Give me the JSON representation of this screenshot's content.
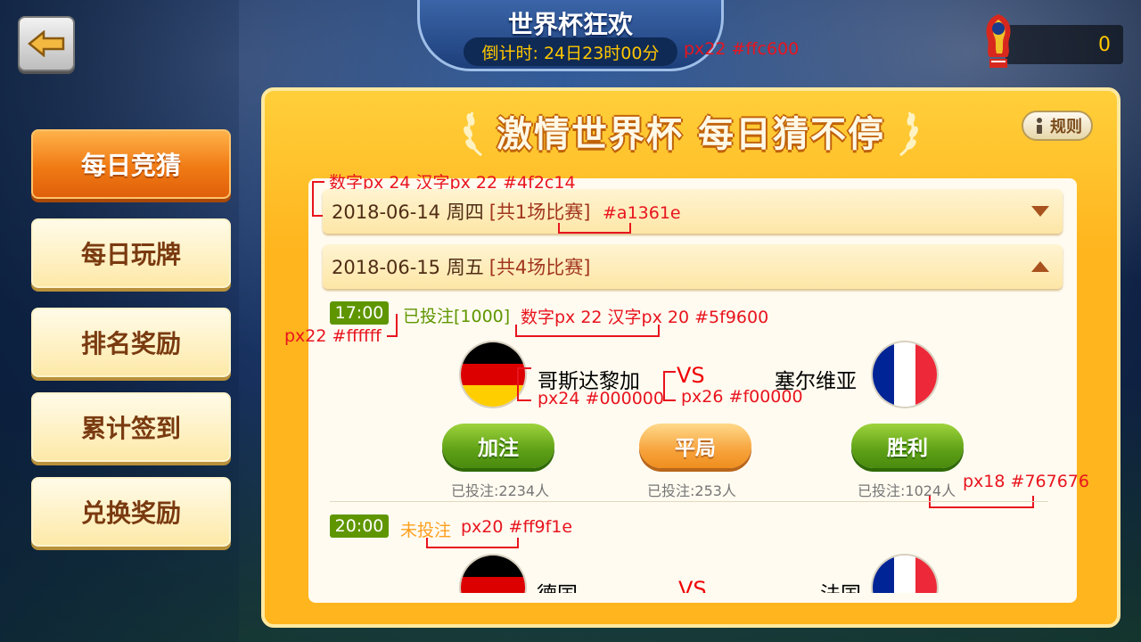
{
  "header": {
    "title": "世界杯狂欢",
    "countdown": "倒计时: 24日23时00分",
    "countdown_note": "px22 #ffc600",
    "score": "0"
  },
  "sidebar": {
    "items": [
      {
        "label": "每日竞猜",
        "active": true
      },
      {
        "label": "每日玩牌",
        "active": false
      },
      {
        "label": "排名奖励",
        "active": false
      },
      {
        "label": "累计签到",
        "active": false
      },
      {
        "label": "兑换奖励",
        "active": false
      }
    ]
  },
  "panel": {
    "title": "激情世界杯 每日猜不停",
    "rules_label": "规则"
  },
  "notes": {
    "date_font": "数字px 24  汉字px 22 #4f2c14",
    "count_color": "#a1361e",
    "time_badge": "px22 #ffffff",
    "bet_status": "数字px 22  汉字px 20 #5f9600",
    "team_font": "px24 #000000",
    "vs_font": "px26 #f00000",
    "bet_count": "px18 #767676",
    "not_bet": "px20 #ff9f1e"
  },
  "days": [
    {
      "date": "2018-06-14 周四",
      "count": "[共1场比赛]",
      "expanded": false
    },
    {
      "date": "2018-06-15 周五",
      "count": "[共4场比赛]",
      "expanded": true
    }
  ],
  "matches": [
    {
      "time": "17:00",
      "status": "已投注[1000]",
      "home": "哥斯达黎加",
      "vs": "VS",
      "away": "塞尔维亚",
      "buttons": [
        "加注",
        "平局",
        "胜利"
      ],
      "counts": [
        "已投注:2234人",
        "已投注:253人",
        "已投注:1024人"
      ]
    },
    {
      "time": "20:00",
      "status": "未投注",
      "home": "德国",
      "vs": "VS",
      "away": "法国"
    }
  ],
  "colors": {
    "accent": "#f07a14",
    "count_red": "#a1361e",
    "bet_green": "#5f9600",
    "not_bet_orange": "#ff9f1e",
    "vs_red": "#f00000"
  }
}
